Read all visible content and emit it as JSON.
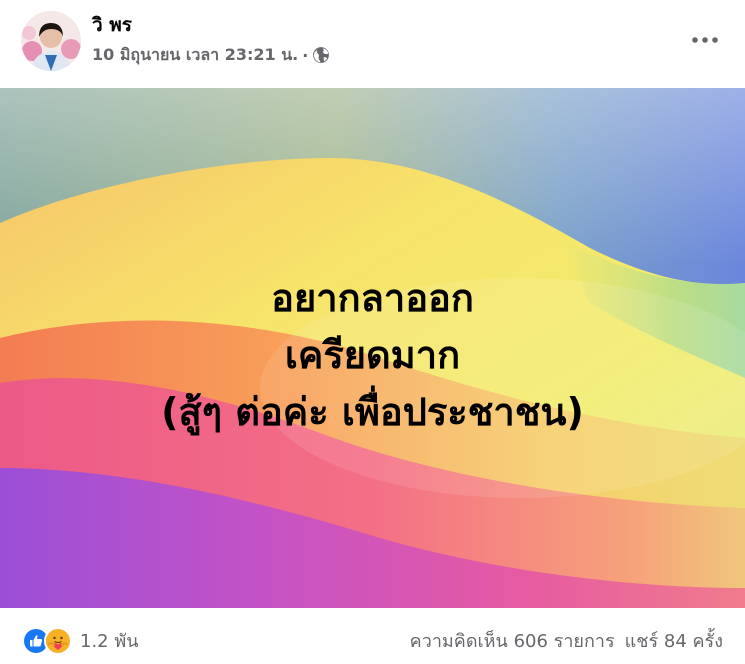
{
  "post": {
    "author_name": "วิ พร",
    "timestamp": "10 มิถุนายน เวลา 23:21 น.",
    "separator": "·",
    "privacy_icon": "globe-icon",
    "more_icon": "more-horizontal-icon",
    "image_text": {
      "line1": "อยากลาออก",
      "line2": "เครียดมาก",
      "line3": "(สู้ๆ ต่อค่ะ เพื่อประชาชน)"
    }
  },
  "footer": {
    "reaction_icons": [
      "like-icon",
      "care-icon"
    ],
    "reaction_count": "1.2 พัน",
    "comments": "ความคิดเห็น 606 รายการ",
    "shares": "แชร์ 84 ครั้ง"
  },
  "colors": {
    "like_blue": "#1877f2",
    "care_yellow": "#f7b125",
    "care_red": "#f33e58",
    "secondary_text": "#65676b"
  }
}
